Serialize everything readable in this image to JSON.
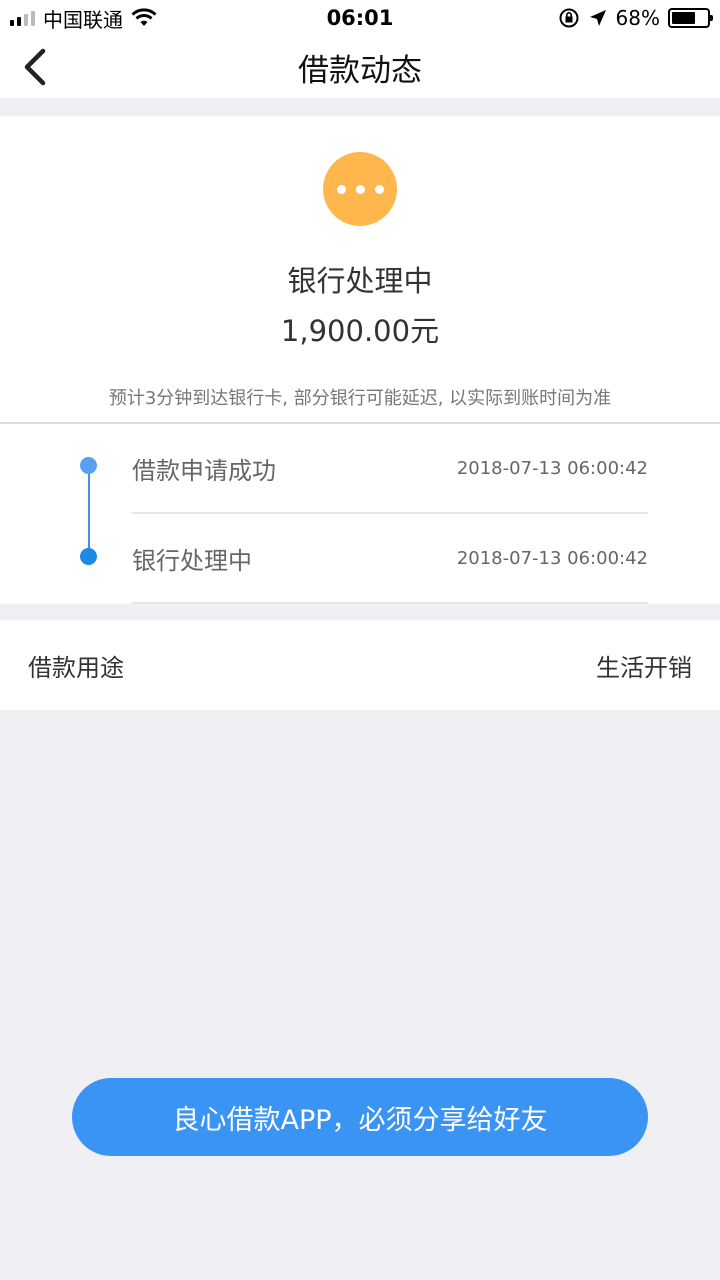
{
  "status_bar": {
    "carrier": "中国联通",
    "time": "06:01",
    "battery_percent": "68%",
    "battery_level": 0.68
  },
  "nav": {
    "title": "借款动态"
  },
  "status": {
    "title": "银行处理中",
    "amount": "1,900.00元",
    "note": "预计3分钟到达银行卡, 部分银行可能延迟, 以实际到账时间为准",
    "icon_color": "#ffb74d"
  },
  "timeline": [
    {
      "label": "借款申请成功",
      "time": "2018-07-13 06:00:42"
    },
    {
      "label": "银行处理中",
      "time": "2018-07-13 06:00:42"
    }
  ],
  "purpose": {
    "label": "借款用途",
    "value": "生活开销"
  },
  "share_button": {
    "label": "良心借款APP，必须分享给好友",
    "color": "#3a94f4"
  }
}
